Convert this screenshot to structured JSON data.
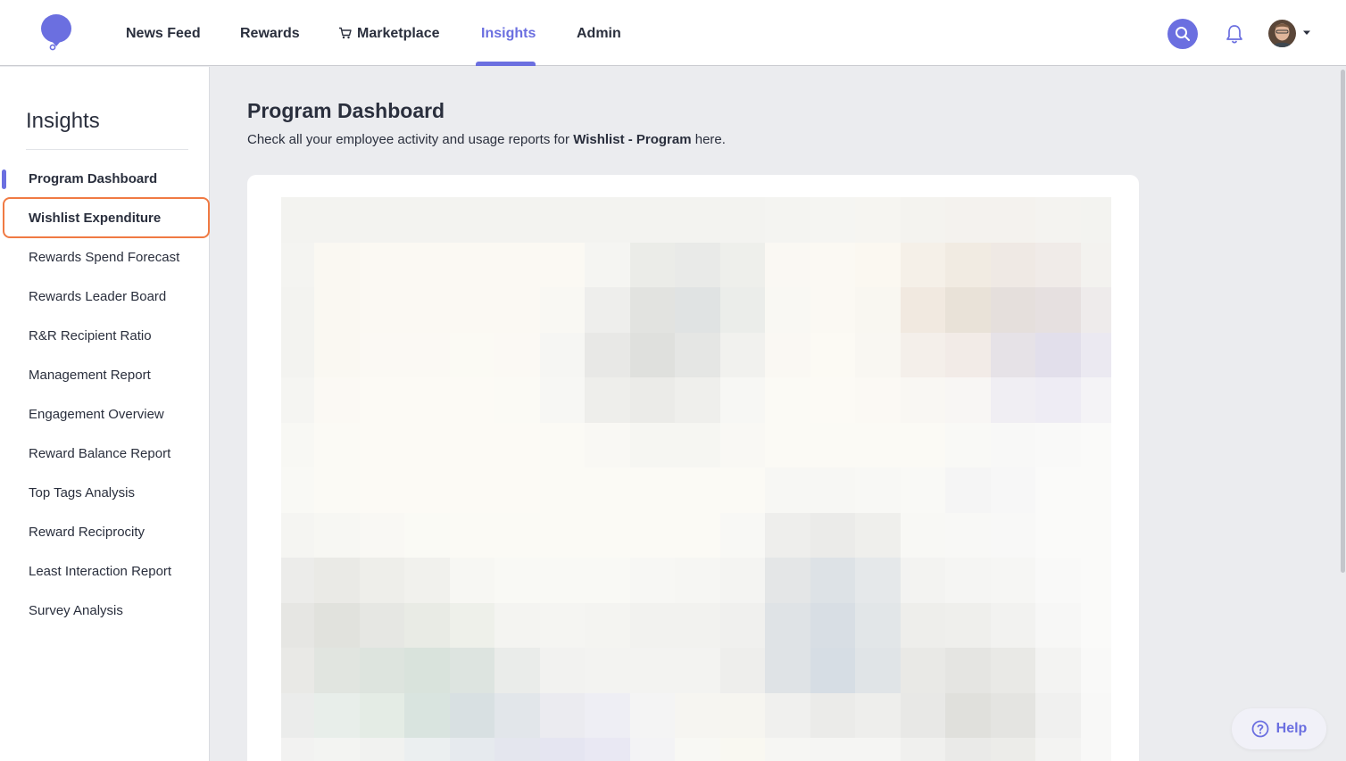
{
  "nav": {
    "items": [
      {
        "label": "News Feed"
      },
      {
        "label": "Rewards"
      },
      {
        "label": "Marketplace"
      },
      {
        "label": "Insights"
      },
      {
        "label": "Admin"
      }
    ],
    "active": "Insights",
    "icons": {
      "logo": "brand-logo-icon",
      "search": "search-icon",
      "bell": "bell-icon",
      "cart": "cart-icon",
      "caret": "caret-down-icon"
    }
  },
  "sidebar": {
    "title": "Insights",
    "items": [
      {
        "label": "Program Dashboard"
      },
      {
        "label": "Wishlist Expenditure"
      },
      {
        "label": "Rewards Spend Forecast"
      },
      {
        "label": "Rewards Leader Board"
      },
      {
        "label": "R&R Recipient Ratio"
      },
      {
        "label": "Management Report"
      },
      {
        "label": "Engagement Overview"
      },
      {
        "label": "Reward Balance Report"
      },
      {
        "label": "Top Tags Analysis"
      },
      {
        "label": "Reward Reciprocity"
      },
      {
        "label": "Least Interaction Report"
      },
      {
        "label": "Survey Analysis"
      }
    ],
    "active_item": "Program Dashboard",
    "highlighted_item": "Wishlist Expenditure"
  },
  "main": {
    "title": "Program Dashboard",
    "subtitle_prefix": "Check all your employee activity and usage reports for",
    "subtitle_program": "Wishlist - Program",
    "subtitle_suffix": "here."
  },
  "help": {
    "label": "Help",
    "icon": "question-circle-icon"
  },
  "colors": {
    "accent": "#6b6fe0",
    "highlight": "#f07a43",
    "text": "#2a2f3d",
    "background": "#ebecef"
  }
}
